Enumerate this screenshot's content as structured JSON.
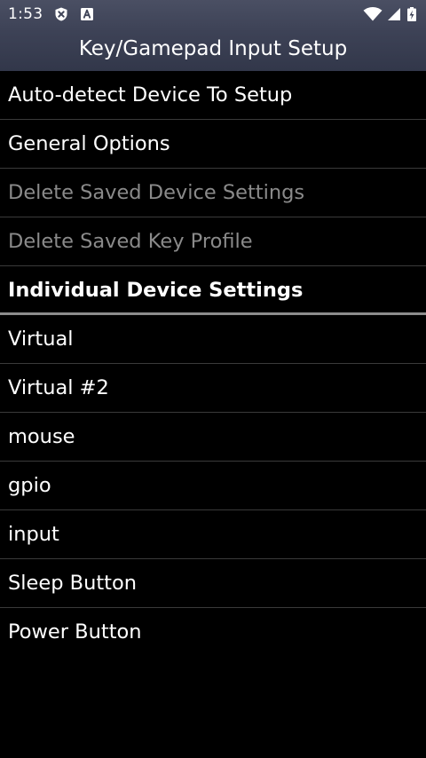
{
  "status_bar": {
    "time": "1:53",
    "icons_left": [
      "shield-x-icon",
      "a-letter-icon"
    ],
    "icons_right": [
      "wifi-icon",
      "cell-signal-icon",
      "battery-charging-icon"
    ]
  },
  "header": {
    "title": "Key/Gamepad Input Setup"
  },
  "menu": {
    "items": [
      {
        "label": "Auto-detect Device To Setup",
        "enabled": true
      },
      {
        "label": "General Options",
        "enabled": true
      },
      {
        "label": "Delete Saved Device Settings",
        "enabled": false
      },
      {
        "label": "Delete Saved Key Profile",
        "enabled": false
      }
    ],
    "section_header": "Individual Device Settings",
    "devices": [
      {
        "label": "Virtual"
      },
      {
        "label": "Virtual #2"
      },
      {
        "label": "mouse"
      },
      {
        "label": "gpio"
      },
      {
        "label": "input"
      },
      {
        "label": "Sleep Button"
      },
      {
        "label": "Power Button"
      }
    ]
  },
  "colors": {
    "background": "#000000",
    "header_top": "#4a4f63",
    "header_bottom": "#32374a",
    "text": "#ffffff",
    "disabled_text": "#8a8a8a",
    "divider": "#3a3a3a"
  }
}
